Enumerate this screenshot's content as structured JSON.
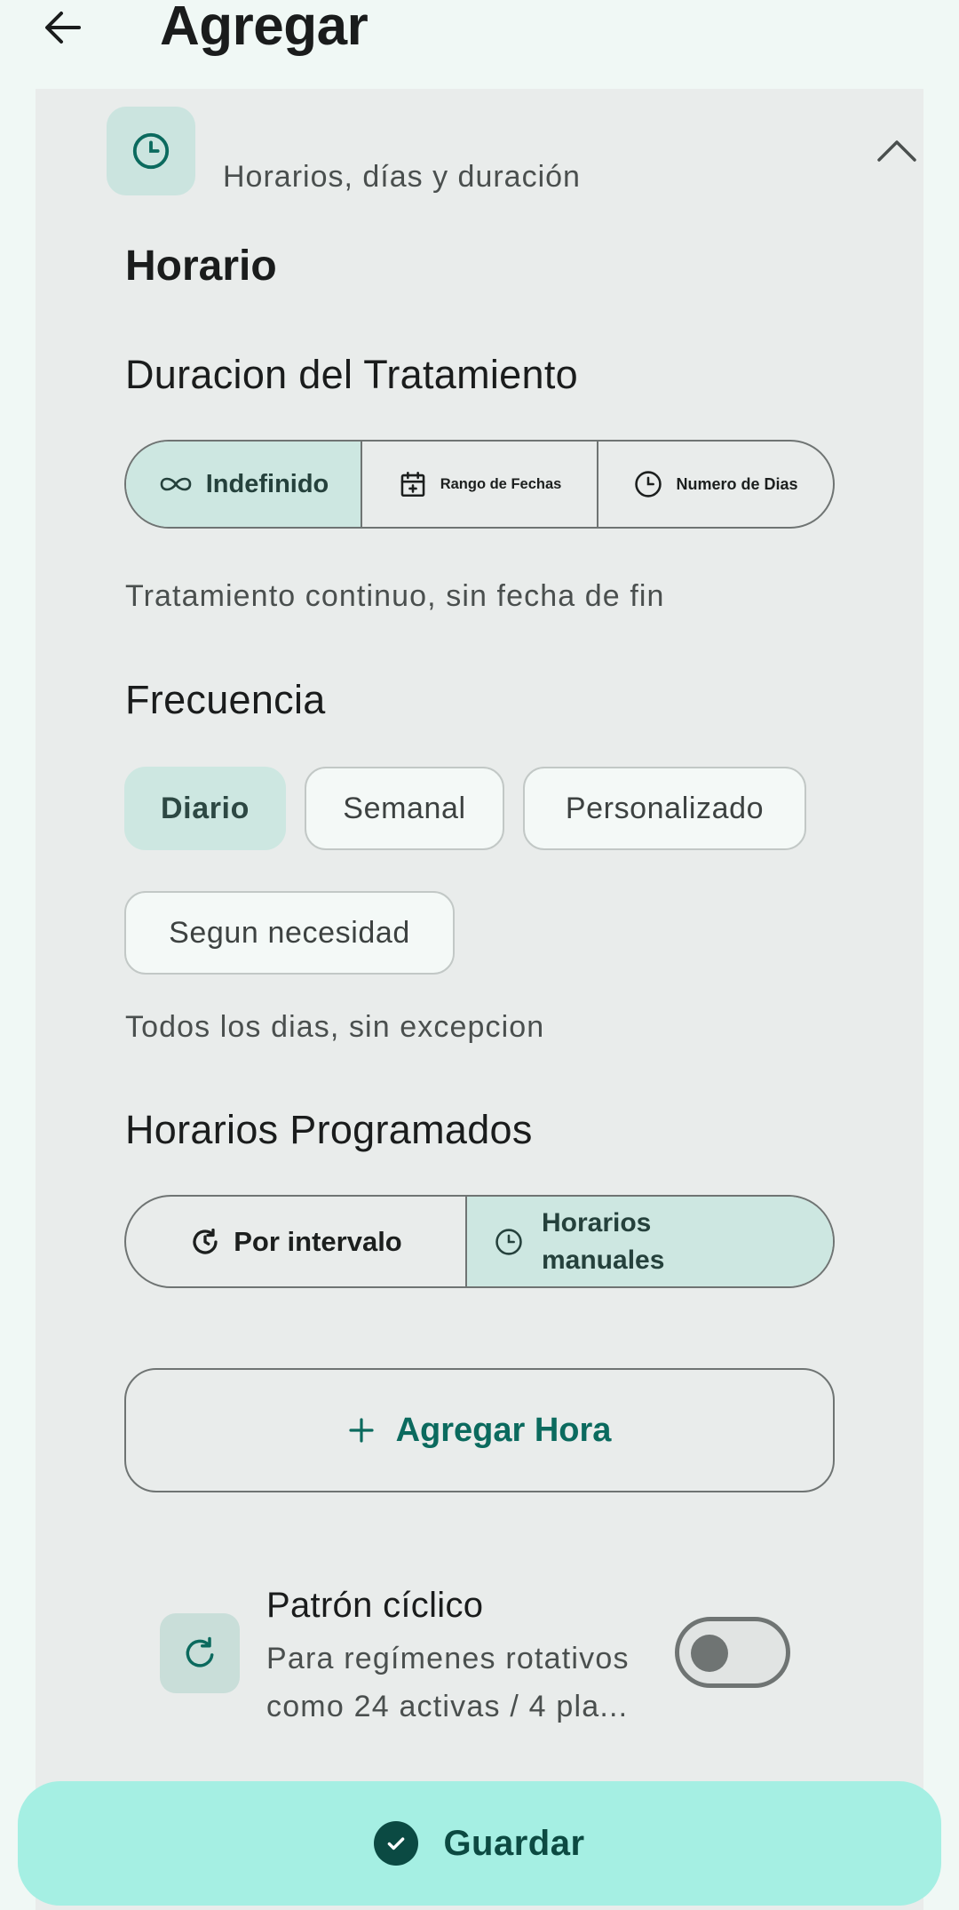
{
  "header": {
    "title": "Agregar",
    "back_icon": "arrow-left-icon"
  },
  "card": {
    "icon": "clock-icon",
    "subtitle": "Horarios, días y duración",
    "collapse_icon": "chevron-up-icon"
  },
  "schedule": {
    "title": "Horario",
    "duration": {
      "label": "Duracion del Tratamiento",
      "options": [
        {
          "label": "Indefinido",
          "icon": "infinity-icon",
          "selected": true
        },
        {
          "label": "Rango de Fechas",
          "icon": "calendar-add-icon",
          "selected": false
        },
        {
          "label": "Numero de Dias",
          "icon": "clock-icon",
          "selected": false
        }
      ],
      "description": "Tratamiento continuo, sin fecha de fin"
    },
    "frequency": {
      "label": "Frecuencia",
      "options": [
        {
          "label": "Diario",
          "selected": true
        },
        {
          "label": "Semanal",
          "selected": false
        },
        {
          "label": "Personalizado",
          "selected": false
        },
        {
          "label": "Segun necesidad",
          "selected": false
        }
      ],
      "description": "Todos los dias, sin excepcion"
    },
    "times": {
      "label": "Horarios Programados",
      "modes": [
        {
          "label": "Por intervalo",
          "icon": "refresh-clock-icon",
          "selected": false
        },
        {
          "label": "Horarios manuales",
          "line1": "Horarios",
          "line2": "manuales",
          "icon": "clock-icon",
          "selected": true
        }
      ],
      "add_label": "Agregar Hora",
      "add_icon": "plus-icon"
    },
    "cyclic": {
      "icon": "refresh-icon",
      "title": "Patrón cíclico",
      "description": "Para regímenes rotativos como 24 activas / 4 pla...",
      "enabled": false
    }
  },
  "footer": {
    "save_label": "Guardar",
    "save_icon": "check-circle-icon"
  },
  "colors": {
    "accent": "#0b6a5e",
    "selected_bg": "#cde7e1",
    "save_bg": "#a5efe3",
    "background": "#f0f8f5",
    "card_bg": "#e9eceb"
  }
}
